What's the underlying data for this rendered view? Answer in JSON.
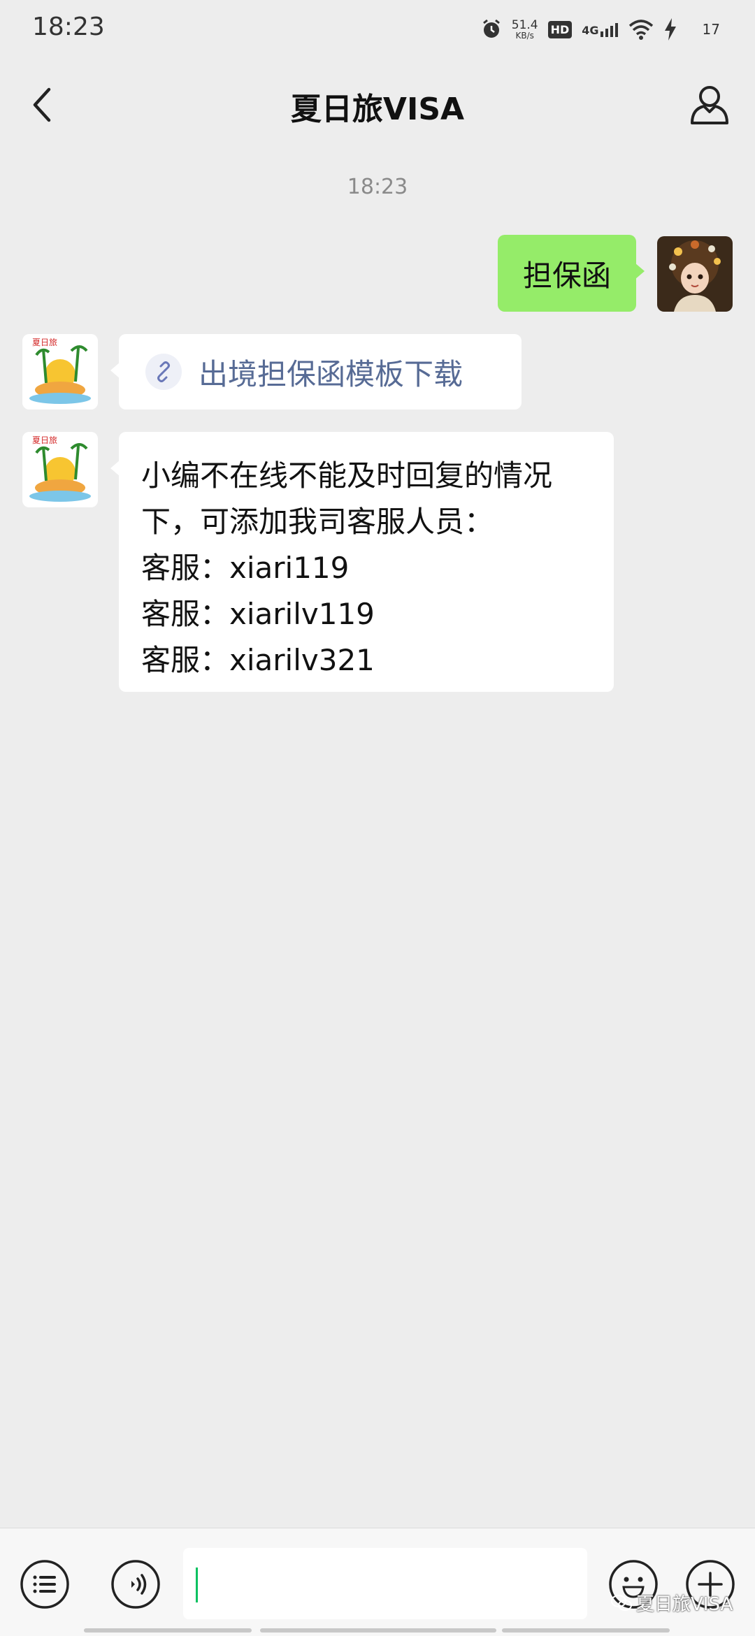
{
  "status_bar": {
    "time": "18:23",
    "net_speed_value": "51.4",
    "net_speed_unit": "KB/s",
    "hd": "HD",
    "network": "4G",
    "battery": "17"
  },
  "header": {
    "title": "夏日旅VISA",
    "back_icon": "chevron-left-icon",
    "profile_icon": "person-icon"
  },
  "chat": {
    "timestamp": "18:23",
    "sent_message": "担保函",
    "link_message": {
      "icon": "link-icon",
      "text": "出境担保函模板下载"
    },
    "text_message": {
      "lines": [
        "小编不在线不能及时回复的情况",
        "下，可添加我司客服人员：",
        "客服：xiari119",
        "客服：xiarilv119",
        "客服：xiarilv321"
      ]
    },
    "bot_avatar_text": "夏日旅"
  },
  "input_bar": {
    "input_value": "",
    "menu_icon": "list-menu-icon",
    "voice_icon": "voice-icon",
    "emoji_icon": "emoji-icon",
    "plus_icon": "plus-icon"
  },
  "watermark": "夏日旅VISA",
  "colors": {
    "background": "#ededed",
    "sent_bubble": "#95ec69",
    "link_text": "#576b95",
    "caret": "#07c160"
  }
}
